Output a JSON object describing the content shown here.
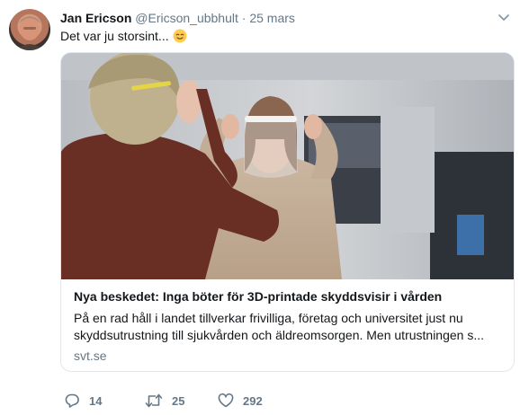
{
  "tweet": {
    "author_name": "Jan Ericson",
    "author_handle": "@Ericson_ubbhult",
    "separator": "·",
    "date": "25 mars",
    "text": "Det var ju storsint...",
    "emoji": "smiling-face-emoji"
  },
  "card": {
    "title": "Nya beskedet: Inga böter för 3D-printade skyddsvisir i vården",
    "description_line1": "På en rad håll i landet tillverkar frivilliga, företag och universitet just nu",
    "description_line2": "skyddsutrustning till sjukvården och äldreomsorgen. Men utrustningen s...",
    "domain": "svt.se"
  },
  "actions": {
    "reply_count": "14",
    "retweet_count": "25",
    "like_count": "292"
  },
  "colors": {
    "text": "#14171a",
    "muted": "#657786",
    "border": "#e1e8ed"
  }
}
